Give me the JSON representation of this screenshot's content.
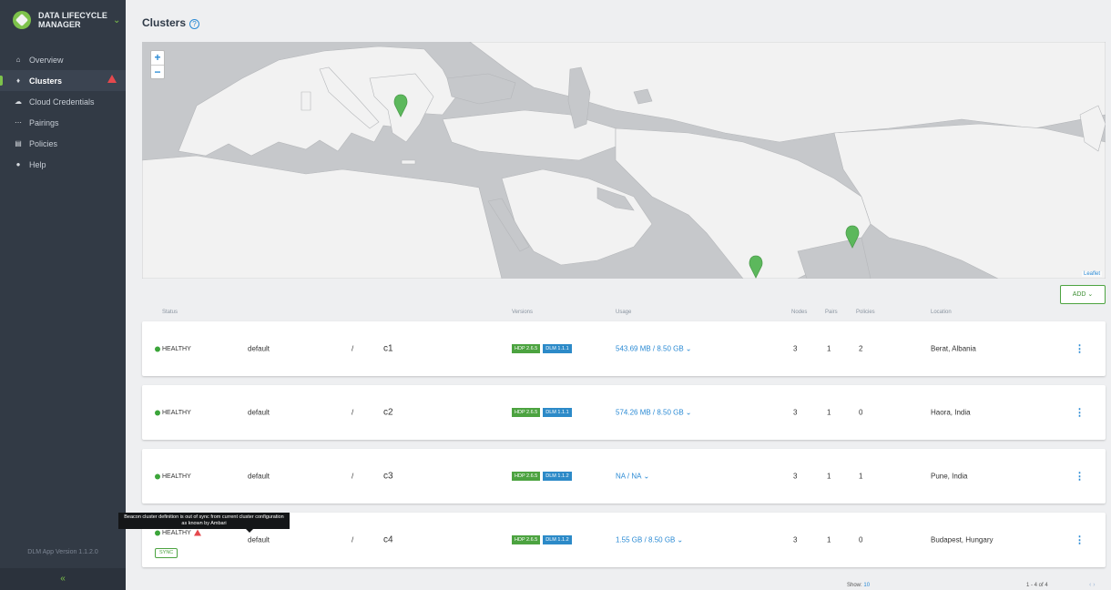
{
  "app": {
    "title": "DATA LIFECYCLE MANAGER",
    "version_text": "DLM App Version 1.1.2.0",
    "collapse_icon": "chevron-left-icon"
  },
  "sidebar": {
    "items": [
      {
        "label": "Overview",
        "icon": "home-icon",
        "active": false
      },
      {
        "label": "Clusters",
        "icon": "clusters-icon",
        "active": true
      },
      {
        "label": "Cloud Credentials",
        "icon": "cloud-icon",
        "active": false
      },
      {
        "label": "Pairings",
        "icon": "pairings-icon",
        "active": false
      },
      {
        "label": "Policies",
        "icon": "policies-icon",
        "active": false
      },
      {
        "label": "Help",
        "icon": "help-icon",
        "active": false
      }
    ]
  },
  "page": {
    "title": "Clusters",
    "help_glyph": "?"
  },
  "map": {
    "zoom_in": "+",
    "zoom_out": "−",
    "attribution": "Leaflet",
    "land_color": "#f2f2f2",
    "sea_color": "#c6c8cb",
    "marker_color": "#5cb85c"
  },
  "toolbar": {
    "add_label": "ADD"
  },
  "table": {
    "headers": {
      "status": "Status",
      "versions": "Versions",
      "usage": "Usage",
      "nodes": "Nodes",
      "pairs": "Pairs",
      "policies": "Policies",
      "location": "Location"
    },
    "rows": [
      {
        "status": "HEALTHY",
        "datacenter": "default",
        "separator": "/",
        "name": "c1",
        "hdp": "HDP 2.6.5",
        "dlm": "DLM 1.1.1",
        "usage": "543.69 MB / 8.50 GB",
        "nodes": "3",
        "pairs": "1",
        "policies": "2",
        "location": "Berat, Albania",
        "warning": false
      },
      {
        "status": "HEALTHY",
        "datacenter": "default",
        "separator": "/",
        "name": "c2",
        "hdp": "HDP 2.6.5",
        "dlm": "DLM 1.1.1",
        "usage": "574.26 MB / 8.50 GB",
        "nodes": "3",
        "pairs": "1",
        "policies": "0",
        "location": "Haora, India",
        "warning": false
      },
      {
        "status": "HEALTHY",
        "datacenter": "default",
        "separator": "/",
        "name": "c3",
        "hdp": "HDP 2.6.5",
        "dlm": "DLM 1.1.2",
        "usage": "NA / NA",
        "nodes": "3",
        "pairs": "1",
        "policies": "1",
        "location": "Pune, India",
        "warning": false
      },
      {
        "status": "HEALTHY",
        "datacenter": "default",
        "separator": "/",
        "name": "c4",
        "hdp": "HDP 2.6.5",
        "dlm": "DLM 1.1.2",
        "usage": "1.55 GB / 8.50 GB",
        "nodes": "3",
        "pairs": "1",
        "policies": "0",
        "location": "Budapest, Hungary",
        "warning": true,
        "sync_label": "SYNC"
      }
    ]
  },
  "tooltip": {
    "text": "Beacon cluster definition is out of sync from current cluster configuration as known by Ambari"
  },
  "footer": {
    "show_label": "Show:",
    "page_size": "10",
    "range": "1 - 4 of 4",
    "pager": "‹ ›"
  },
  "colors": {
    "sidebar_bg": "#323a45",
    "accent_green": "#4ca340",
    "link_blue": "#2a8ad4",
    "alert_red": "#e5484d"
  }
}
